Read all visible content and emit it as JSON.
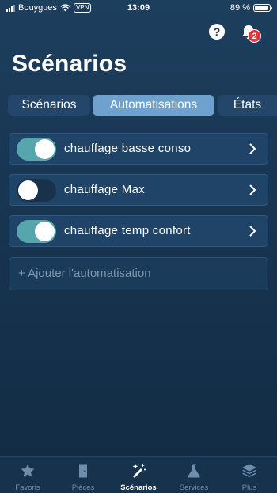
{
  "status_bar": {
    "carrier": "Bouygues",
    "vpn": "VPN",
    "time": "13:09",
    "battery": "89 %",
    "battery_level": 0.89
  },
  "header": {
    "help_label": "?",
    "notification_count": "2",
    "title": "Scénarios"
  },
  "tabs": [
    {
      "label": "Scénarios",
      "selected": false
    },
    {
      "label": "Automatisations",
      "selected": true
    },
    {
      "label": "États",
      "selected": false
    }
  ],
  "automations": [
    {
      "label": "chauffage basse conso",
      "enabled": true
    },
    {
      "label": "chauffage Max",
      "enabled": false
    },
    {
      "label": "chauffage temp confort",
      "enabled": true
    }
  ],
  "add_button": "+ Ajouter l'automatisation",
  "bottom_nav": [
    {
      "label": "Favoris",
      "icon": "star-icon",
      "active": false
    },
    {
      "label": "Pièces",
      "icon": "door-icon",
      "active": false
    },
    {
      "label": "Scénarios",
      "icon": "magic-wand-icon",
      "active": true
    },
    {
      "label": "Services",
      "icon": "flask-icon",
      "active": false
    },
    {
      "label": "Plus",
      "icon": "layers-icon",
      "active": false
    }
  ],
  "colors": {
    "background": "#1b3a57",
    "toggle_on": "#55a7ad",
    "tab_selected": "#6fa1cf",
    "badge": "#e5333b"
  }
}
